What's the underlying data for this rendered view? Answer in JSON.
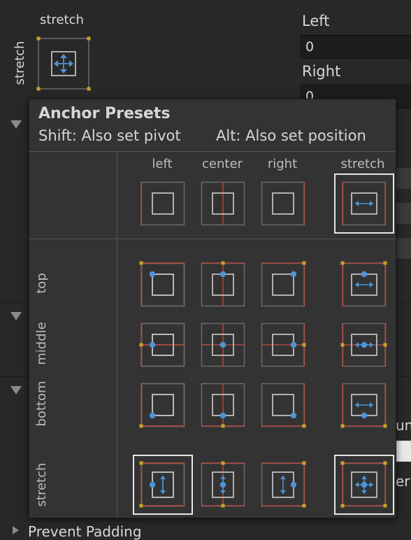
{
  "inspector": {
    "preset_top_label": "stretch",
    "preset_side_label": "stretch",
    "fields": [
      {
        "label": "Left",
        "value": "0"
      },
      {
        "label": "Right",
        "value": "0"
      }
    ],
    "obscured_right_texts": [
      "un",
      "eri"
    ],
    "bottom_partial_label": "Prevent Padding"
  },
  "popup": {
    "title": "Anchor Presets",
    "hint_pivot": "Shift: Also set pivot",
    "hint_position": "Alt: Also set position",
    "columns": [
      "left",
      "center",
      "right",
      "stretch"
    ],
    "rows": [
      "top",
      "middle",
      "bottom",
      "stretch"
    ],
    "selected": {
      "horizontal": "stretch",
      "vertical": "stretch"
    }
  },
  "colors": {
    "anchor_line": "#b04a40",
    "anchor_handle": "#c9a227",
    "pivot": "#4d93d6",
    "frame": "#6a6a6a",
    "rect": "#bdbdbd",
    "selection": "#e6e6e6"
  }
}
